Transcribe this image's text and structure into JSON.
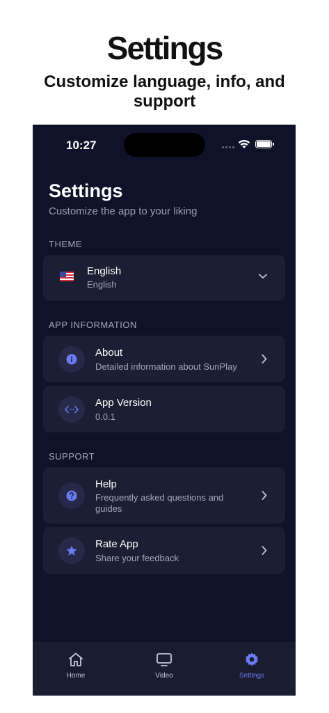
{
  "promo": {
    "title": "Settings",
    "subtitle": "Customize language, info, and support"
  },
  "status": {
    "time": "10:27"
  },
  "header": {
    "title": "Settings",
    "subtitle": "Customize the app to your liking"
  },
  "theme": {
    "label": "THEME",
    "language_title": "English",
    "language_sub": "English",
    "flag_icon": "us-flag-icon"
  },
  "app_info": {
    "label": "APP INFORMATION",
    "about_title": "About",
    "about_desc": "Detailed information about SunPlay",
    "version_title": "App Version",
    "version_value": "0.0.1"
  },
  "support": {
    "label": "SUPPORT",
    "help_title": "Help",
    "help_desc": "Frequently asked questions and guides",
    "rate_title": "Rate App",
    "rate_desc": "Share your feedback"
  },
  "tabs": [
    {
      "label": "Home",
      "icon": "home-icon"
    },
    {
      "label": "Video",
      "icon": "tv-icon"
    },
    {
      "label": "Settings",
      "icon": "gear-icon"
    }
  ],
  "colors": {
    "accent": "#6a7bf5",
    "background": "#10122a",
    "card": "#1c1e33"
  }
}
